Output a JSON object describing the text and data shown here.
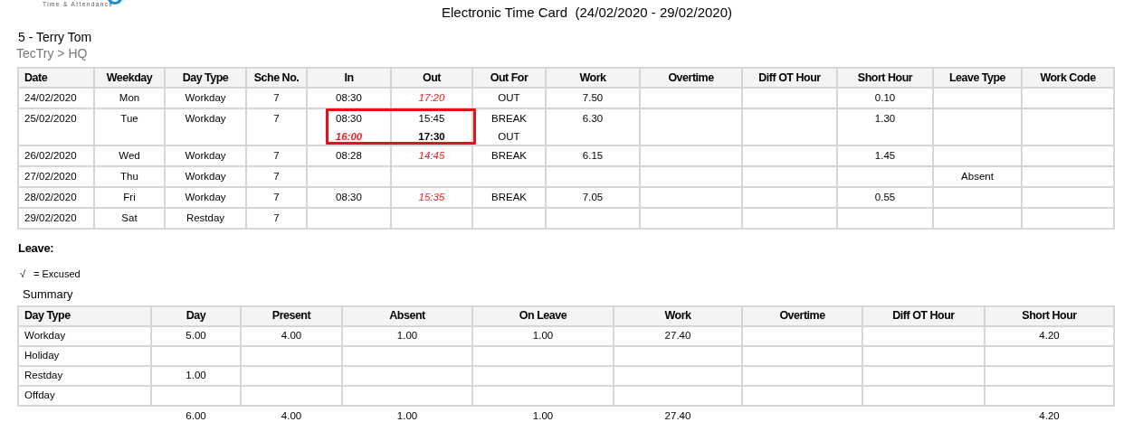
{
  "logo": {
    "tagline": "Time & Attendance"
  },
  "title": "Electronic Time Card  (24/02/2020 - 29/02/2020)",
  "employee": "5 - Terry Tom",
  "location": "TecTry > HQ",
  "time_card": {
    "columns": [
      "Date",
      "Weekday",
      "Day Type",
      "Sche No.",
      "In",
      "Out",
      "Out For",
      "Work",
      "Overtime",
      "Diff OT Hour",
      "Short Hour",
      "Leave Type",
      "Work Code"
    ],
    "rows": [
      {
        "highlighted": false,
        "date": "24/02/2020",
        "weekday": "Mon",
        "day_type": "Workday",
        "sche_no": "7",
        "in": [
          {
            "time": "08:30",
            "kind": "plain"
          }
        ],
        "out": [
          {
            "time": "17:20",
            "kind": "irregular"
          }
        ],
        "out_for": [
          "OUT"
        ],
        "work": "7.50",
        "short_hour": "0.10"
      },
      {
        "highlighted": true,
        "date": "25/02/2020",
        "weekday": "Tue",
        "day_type": "Workday",
        "sche_no": "7",
        "in": [
          {
            "time": "08:30",
            "kind": "plain"
          },
          {
            "time": "16:00",
            "kind": "irregular_bold"
          }
        ],
        "out": [
          {
            "time": "15:45",
            "kind": "plain"
          },
          {
            "time": "17:30",
            "kind": "bold"
          }
        ],
        "out_for": [
          "BREAK",
          "OUT"
        ],
        "work": "6.30",
        "short_hour": "1.30"
      },
      {
        "highlighted": false,
        "date": "26/02/2020",
        "weekday": "Wed",
        "day_type": "Workday",
        "sche_no": "7",
        "in": [
          {
            "time": "08:28",
            "kind": "plain"
          }
        ],
        "out": [
          {
            "time": "14:45",
            "kind": "irregular"
          }
        ],
        "out_for": [
          "BREAK"
        ],
        "work": "6.15",
        "short_hour": "1.45"
      },
      {
        "highlighted": false,
        "date": "27/02/2020",
        "weekday": "Thu",
        "day_type": "Workday",
        "sche_no": "7",
        "leave_type": "Absent"
      },
      {
        "highlighted": false,
        "date": "28/02/2020",
        "weekday": "Fri",
        "day_type": "Workday",
        "sche_no": "7",
        "in": [
          {
            "time": "08:30",
            "kind": "plain"
          }
        ],
        "out": [
          {
            "time": "15:35",
            "kind": "irregular"
          }
        ],
        "out_for": [
          "BREAK"
        ],
        "work": "7.05",
        "short_hour": "0.55"
      },
      {
        "highlighted": false,
        "date": "29/02/2020",
        "weekday": "Sat",
        "day_type": "Restday",
        "sche_no": "7"
      }
    ]
  },
  "leave": {
    "heading": "Leave:",
    "legend_symbol": "√",
    "legend_text": "= Excused"
  },
  "summary": {
    "heading": "Summary",
    "columns": [
      "Day Type",
      "Day",
      "Present",
      "Absent",
      "On Leave",
      "Work",
      "Overtime",
      "Diff OT Hour",
      "Short Hour"
    ],
    "rows": [
      {
        "day_type": "Workday",
        "day": "5.00",
        "present": "4.00",
        "absent": "1.00",
        "on_leave": "1.00",
        "work": "27.40",
        "short_hour": "4.20"
      },
      {
        "day_type": "Holiday"
      },
      {
        "day_type": "Restday",
        "day": "1.00"
      },
      {
        "day_type": "Offday"
      }
    ],
    "totals": {
      "day": "6.00",
      "present": "4.00",
      "absent": "1.00",
      "on_leave": "1.00",
      "work": "27.40",
      "short_hour": "4.20"
    }
  }
}
